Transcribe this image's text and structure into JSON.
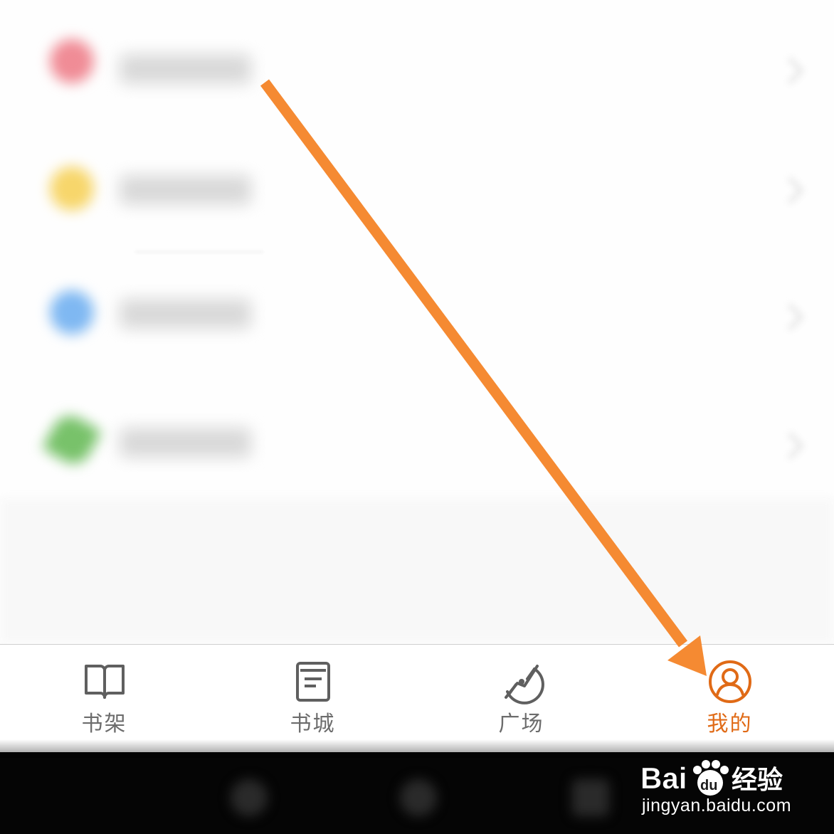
{
  "list": {
    "rows": [
      {
        "label": "",
        "icon": "red-circle-icon",
        "icon_color": "#f08c96"
      },
      {
        "label": "",
        "icon": "yellow-circle-icon",
        "icon_color": "#f7d66b"
      },
      {
        "label": "",
        "icon": "blue-circle-icon",
        "icon_color": "#7fb8f2"
      },
      {
        "label": "",
        "icon": "green-phone-icon",
        "icon_color": "#78c26a"
      }
    ]
  },
  "tabbar": {
    "tabs": [
      {
        "label": "书架",
        "icon": "open-book-icon",
        "active": false
      },
      {
        "label": "书城",
        "icon": "document-icon",
        "active": false
      },
      {
        "label": "广场",
        "icon": "compass-icon",
        "active": false
      },
      {
        "label": "我的",
        "icon": "user-circle-icon",
        "active": true
      }
    ],
    "active_color": "#e06a16",
    "inactive_color": "#6c6c6c"
  },
  "annotation": {
    "color": "#f58a32",
    "icon": "orange-arrow"
  },
  "watermark": {
    "logo": "Bai du 经验",
    "url": "jingyan.baidu.com"
  }
}
